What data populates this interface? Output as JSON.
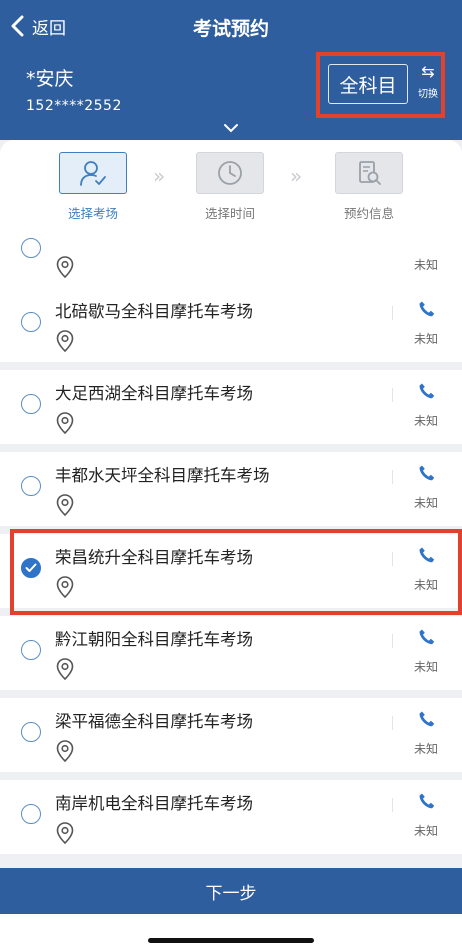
{
  "header": {
    "back_label": "返回",
    "title": "考试预约",
    "city": "*安庆",
    "phone": "152****2552",
    "subject_button": "全科目",
    "switch_label": "切换",
    "switch_glyph": "⇆"
  },
  "steps": [
    {
      "label": "选择考场",
      "icon": "person-check-icon",
      "active": true
    },
    {
      "label": "选择时间",
      "icon": "clock-icon",
      "active": false
    },
    {
      "label": "预约信息",
      "icon": "document-search-icon",
      "active": false
    }
  ],
  "list": {
    "items": [
      {
        "name": "北碚歇马全科目摩托车考场",
        "status": "未知",
        "selected": false
      },
      {
        "name": "大足西湖全科目摩托车考场",
        "status": "未知",
        "selected": false
      },
      {
        "name": "丰都水天坪全科目摩托车考场",
        "status": "未知",
        "selected": false
      },
      {
        "name": "荣昌统升全科目摩托车考场",
        "status": "未知",
        "selected": true
      },
      {
        "name": "黔江朝阳全科目摩托车考场",
        "status": "未知",
        "selected": false
      },
      {
        "name": "梁平福德全科目摩托车考场",
        "status": "未知",
        "selected": false
      },
      {
        "name": "南岸机电全科目摩托车考场",
        "status": "未知",
        "selected": false
      }
    ],
    "partial_item_status": "未知"
  },
  "footer": {
    "next_button": "下一步"
  },
  "colors": {
    "brand": "#2f5e9e",
    "accent": "#2f74c8",
    "highlight_frame": "#e2412c"
  }
}
